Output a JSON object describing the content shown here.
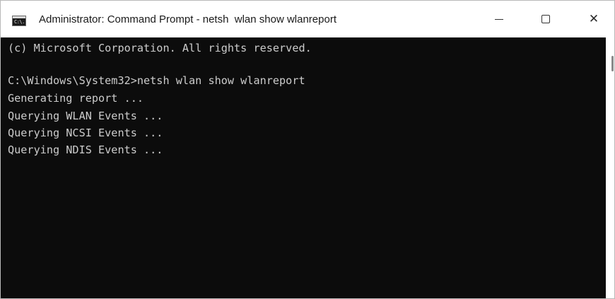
{
  "window": {
    "title": "Administrator: Command Prompt - netsh  wlan show wlanreport",
    "app_icon_text": "C:\\."
  },
  "controls": {
    "minimize": "minimize-icon",
    "maximize": "maximize-icon",
    "close": "close-icon",
    "close_glyph": "✕"
  },
  "terminal": {
    "lines": [
      "(c) Microsoft Corporation. All rights reserved.",
      "C:\\Windows\\System32>netsh wlan show wlanreport",
      "Generating report ...",
      "Querying WLAN Events ...",
      "Querying NCSI Events ...",
      "Querying NDIS Events ..."
    ],
    "background": "#0c0c0c",
    "foreground": "#cccccc"
  }
}
